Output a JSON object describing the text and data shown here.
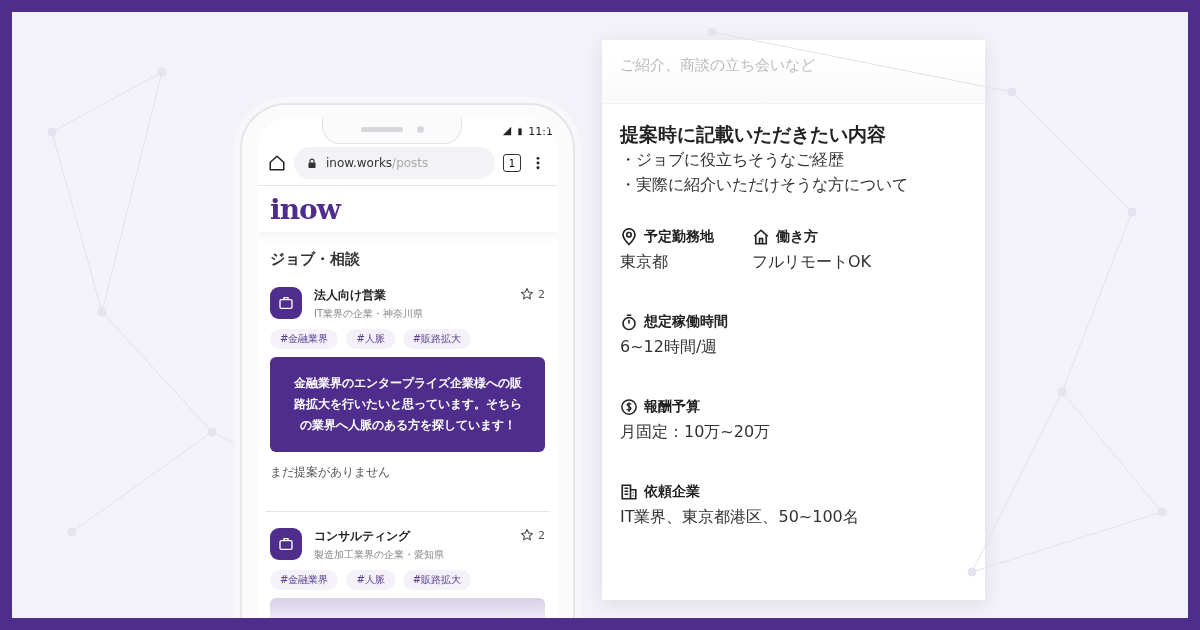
{
  "browser": {
    "time": "11:1",
    "url_host": "inow.works",
    "url_path": "/posts",
    "tab_count": "1"
  },
  "site": {
    "logo": "inow"
  },
  "section_title": "ジョブ・相談",
  "posts": [
    {
      "title": "法人向け営業",
      "subtitle": "IT業界の企業・神奈川県",
      "favorites": "2",
      "tags": [
        "#金融業界",
        "#人脈",
        "#販路拡大"
      ],
      "message": "金融業界のエンタープライズ企業様への販路拡大を行いたいと思っています。そちらの業界へ人脈のある方を探しています！",
      "note": "まだ提案がありません"
    },
    {
      "title": "コンサルティング",
      "subtitle": "製造加工業界の企業・愛知県",
      "favorites": "2",
      "tags": [
        "#金融業界",
        "#人脈",
        "#販路拡大"
      ]
    }
  ],
  "detail_card": {
    "faded_text": "ご紹介、商談の立ち会いなど",
    "heading": "提案時に記載いただきたい内容",
    "bullets": [
      "・ジョブに役立ちそうなご経歴",
      "・実際に紹介いただけそうな方について"
    ],
    "field_rows": [
      [
        {
          "label": "予定勤務地",
          "value": "東京都"
        },
        {
          "label": "働き方",
          "value": "フルリモートOK"
        }
      ],
      [
        {
          "label": "想定稼働時間",
          "value": "6~12時間/週"
        }
      ],
      [
        {
          "label": "報酬予算",
          "value": "月固定：10万~20万"
        }
      ],
      [
        {
          "label": "依頼企業",
          "value": "IT業界、東京都港区、50~100名"
        }
      ]
    ]
  }
}
